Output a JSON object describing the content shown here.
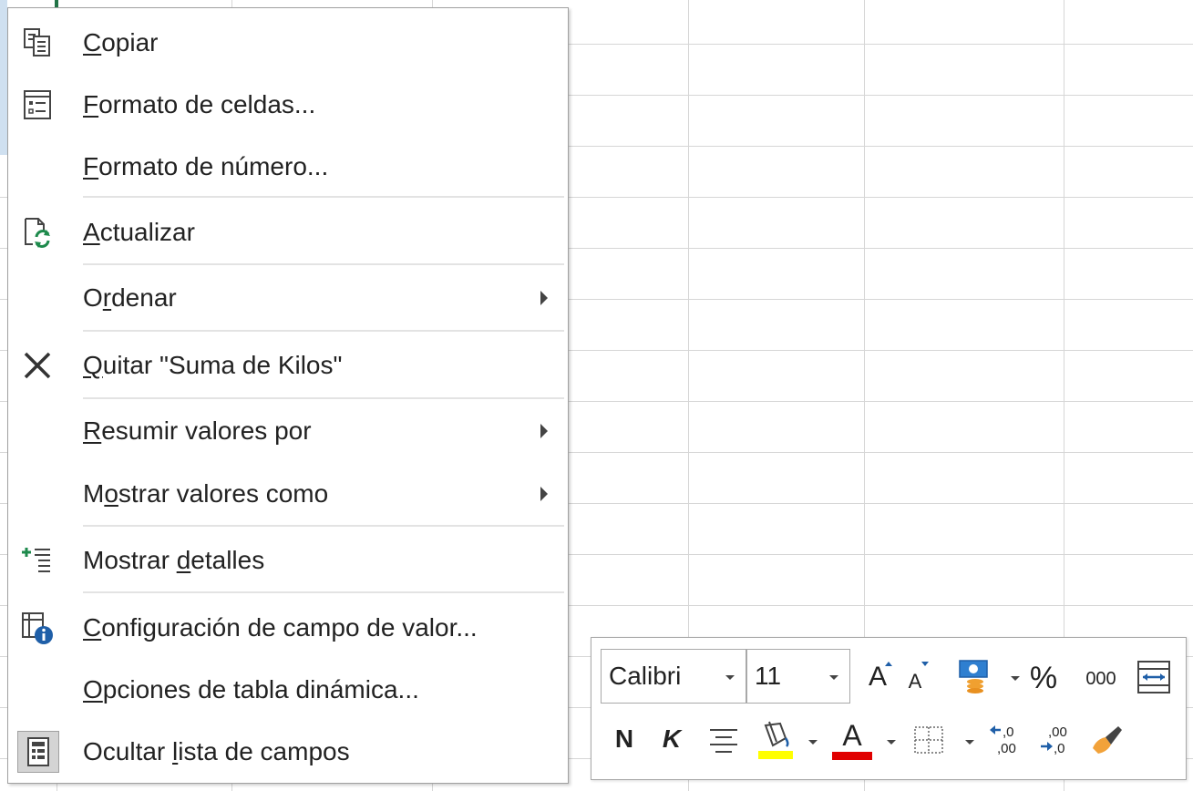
{
  "context_menu": {
    "items": [
      {
        "pre": "",
        "acc": "C",
        "post": "opiar"
      },
      {
        "pre": "",
        "acc": "F",
        "post": "ormato de celdas..."
      },
      {
        "pre": "",
        "acc": "F",
        "post": "ormato de número..."
      },
      {
        "pre": "",
        "acc": "A",
        "post": "ctualizar"
      },
      {
        "pre": "O",
        "acc": "r",
        "post": "denar"
      },
      {
        "pre": "",
        "acc": "Q",
        "post": "uitar \"Suma de Kilos\""
      },
      {
        "pre": "",
        "acc": "R",
        "post": "esumir valores por"
      },
      {
        "pre": "M",
        "acc": "o",
        "post": "strar valores como"
      },
      {
        "pre": "Mostrar ",
        "acc": "d",
        "post": "etalles"
      },
      {
        "pre": "",
        "acc": "C",
        "post": "onfiguración de campo de valor..."
      },
      {
        "pre": "",
        "acc": "O",
        "post": "pciones de tabla dinámica..."
      },
      {
        "pre": "Ocultar ",
        "acc": "l",
        "post": "ista de campos"
      }
    ]
  },
  "mini_toolbar": {
    "font_name": "Calibri",
    "font_size": "11",
    "bold_label": "N",
    "italic_label": "K",
    "percent_label": "%",
    "thousands_label": "000",
    "font_color_label": "A",
    "grow_label": "A",
    "shrink_label": "A",
    "fill_color": "#ffff00",
    "font_color": "#e00000"
  }
}
